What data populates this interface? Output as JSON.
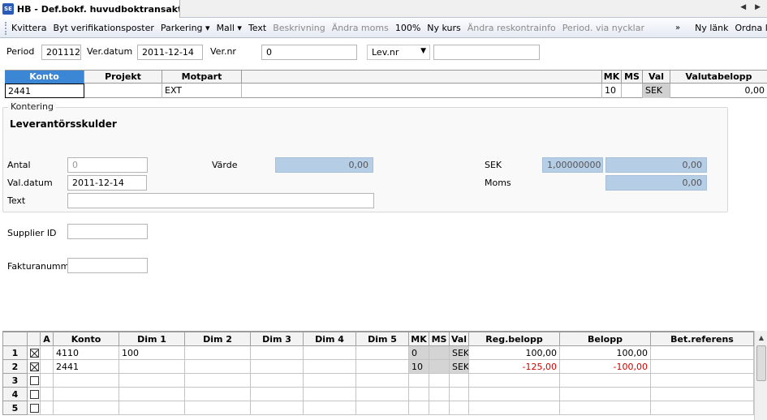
{
  "window": {
    "app_icon": "SE",
    "tab_title": "HB - Def.bokf. huvudboktransakt..."
  },
  "toolbar": {
    "items": [
      {
        "label": "Kvittera",
        "enabled": true
      },
      {
        "label": "Byt verifikationsposter",
        "enabled": true
      },
      {
        "label": "Parkering ▾",
        "enabled": true
      },
      {
        "label": "Mall ▾",
        "enabled": true
      },
      {
        "label": "Text",
        "enabled": true
      },
      {
        "label": "Beskrivning",
        "enabled": false
      },
      {
        "label": "Ändra moms",
        "enabled": false
      },
      {
        "label": "100%",
        "enabled": true
      },
      {
        "label": "Ny kurs",
        "enabled": true
      },
      {
        "label": "Ändra reskontrainfo",
        "enabled": false
      },
      {
        "label": "Period. via nycklar",
        "enabled": false
      }
    ],
    "overflow": "»",
    "right_items": [
      {
        "label": "Ny länk"
      },
      {
        "label": "Ordna länkar"
      }
    ]
  },
  "header": {
    "period_label": "Period",
    "period_value": "201112",
    "verdatum_label": "Ver.datum",
    "verdatum_value": "2011-12-14",
    "vernr_label": "Ver.nr",
    "vernr_value": "0",
    "levnr_select": "Lev.nr",
    "levnr_value": ""
  },
  "top_grid": {
    "columns": [
      "Konto",
      "Projekt",
      "Motpart",
      "",
      "MK",
      "MS",
      "Val",
      "Valutabelopp"
    ],
    "row": {
      "konto": "2441",
      "projekt": "",
      "motpart": "EXT",
      "desc": "",
      "mk": "10",
      "ms": "",
      "val": "SEK",
      "valutabelopp": "0,00"
    }
  },
  "kontering": {
    "legend": "Kontering",
    "account_name": "Leverantörsskulder",
    "antal_label": "Antal",
    "antal_value": "0",
    "varde_label": "Värde",
    "varde_value": "0,00",
    "sek_label": "SEK",
    "sek_rate": "1,00000000",
    "sek_value": "0,00",
    "valdatum_label": "Val.datum",
    "valdatum_value": "2011-12-14",
    "moms_label": "Moms",
    "moms_value": "0,00",
    "text_label": "Text",
    "text_value": ""
  },
  "extra_fields": {
    "supplier_label": "Supplier ID",
    "supplier_value": "",
    "faktura_label": "Fakturanummer",
    "faktura_value": ""
  },
  "bottom_grid": {
    "columns": [
      "",
      "",
      "A",
      "Konto",
      "Dim 1",
      "Dim 2",
      "Dim 3",
      "Dim 4",
      "Dim 5",
      "MK",
      "MS",
      "Val",
      "Reg.belopp",
      "Belopp",
      "Bet.referens"
    ],
    "rows": [
      {
        "n": "1",
        "checked": true,
        "konto": "4110",
        "dim1": "100",
        "mk": "0",
        "val": "SEK",
        "reg": "100,00",
        "belopp": "100,00",
        "neg": false
      },
      {
        "n": "2",
        "checked": true,
        "konto": "2441",
        "dim1": "",
        "mk": "10",
        "val": "SEK",
        "reg": "-125,00",
        "belopp": "-100,00",
        "neg": true
      },
      {
        "n": "3",
        "checked": false,
        "konto": "",
        "dim1": "",
        "mk": "",
        "val": "",
        "reg": "",
        "belopp": "",
        "neg": false
      },
      {
        "n": "4",
        "checked": false,
        "konto": "",
        "dim1": "",
        "mk": "",
        "val": "",
        "reg": "",
        "belopp": "",
        "neg": false
      },
      {
        "n": "5",
        "checked": false,
        "konto": "",
        "dim1": "",
        "mk": "",
        "val": "",
        "reg": "",
        "belopp": "",
        "neg": false
      }
    ]
  }
}
